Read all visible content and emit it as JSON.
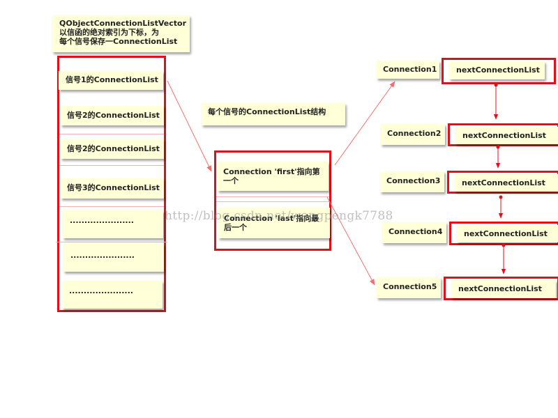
{
  "vector_note": {
    "line1": "QObjectConnectionListVector",
    "line2": "以信函的绝对索引为下标，为",
    "line3": "每个信号保存一ConnectionList"
  },
  "signal_list": [
    {
      "label": "信号1的ConnectionList"
    },
    {
      "label": "信号2的ConnectionList"
    },
    {
      "label": "信号2的ConnectionList"
    },
    {
      "label": "信号3的ConnectionList"
    },
    {
      "label": "......................"
    },
    {
      "label": "......................"
    },
    {
      "label": "......................"
    }
  ],
  "structure_note": "每个信号的ConnectionList结构",
  "first_node": {
    "line1": "Connection 'first'指向第",
    "line2": "一个"
  },
  "last_node": {
    "line1": "Connection 'last'指向最",
    "line2": "后一个"
  },
  "connections": [
    {
      "label": "Connection1",
      "next": "nextConnectionList"
    },
    {
      "label": "Connection2",
      "next": "nextConnectionList"
    },
    {
      "label": "Connection3",
      "next": "nextConnectionList"
    },
    {
      "label": "Connection4",
      "next": "nextConnectionList"
    },
    {
      "label": "Connection5",
      "next": "nextConnectionList"
    }
  ],
  "watermark": "http://blog.csdn.net/wangpengk7788",
  "colors": {
    "highlight_border": "#e0101a",
    "note_fill": "#ffffd8",
    "arrow": "#f07070"
  }
}
